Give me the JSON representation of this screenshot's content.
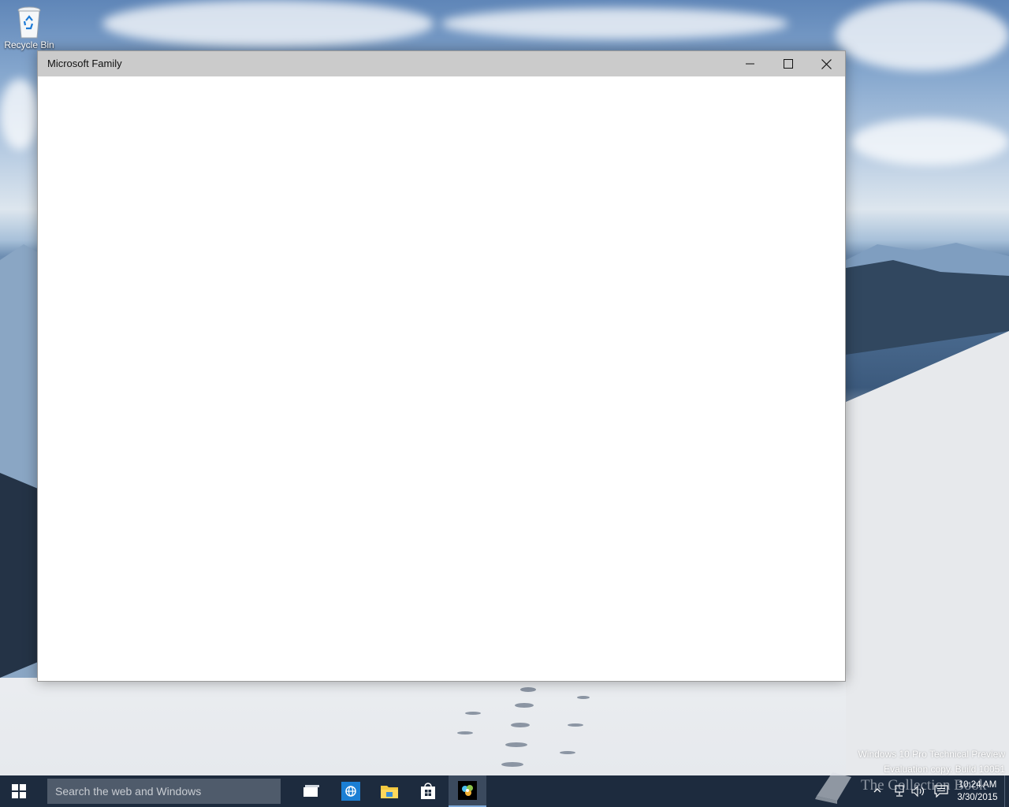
{
  "desktop": {
    "recycle_bin_label": "Recycle Bin",
    "watermark_line1": "Windows 10 Pro Technical Preview",
    "watermark_line2": "Evaluation copy. Build 10051",
    "brand_text": "The Collection Book"
  },
  "window": {
    "title": "Microsoft Family",
    "minimize_icon": "minimize-icon",
    "maximize_icon": "maximize-icon",
    "close_icon": "close-icon"
  },
  "taskbar": {
    "search_placeholder": "Search the web and Windows",
    "apps": [
      "task-view",
      "internet-explorer",
      "file-explorer",
      "store",
      "microsoft-family"
    ],
    "active_app": "microsoft-family",
    "time": "10:24 AM",
    "date": "3/30/2015",
    "colors": {
      "taskbar": "#1d2b3e",
      "search_box": "#4f5b6b",
      "titlebar": "#cbcbcb"
    }
  }
}
